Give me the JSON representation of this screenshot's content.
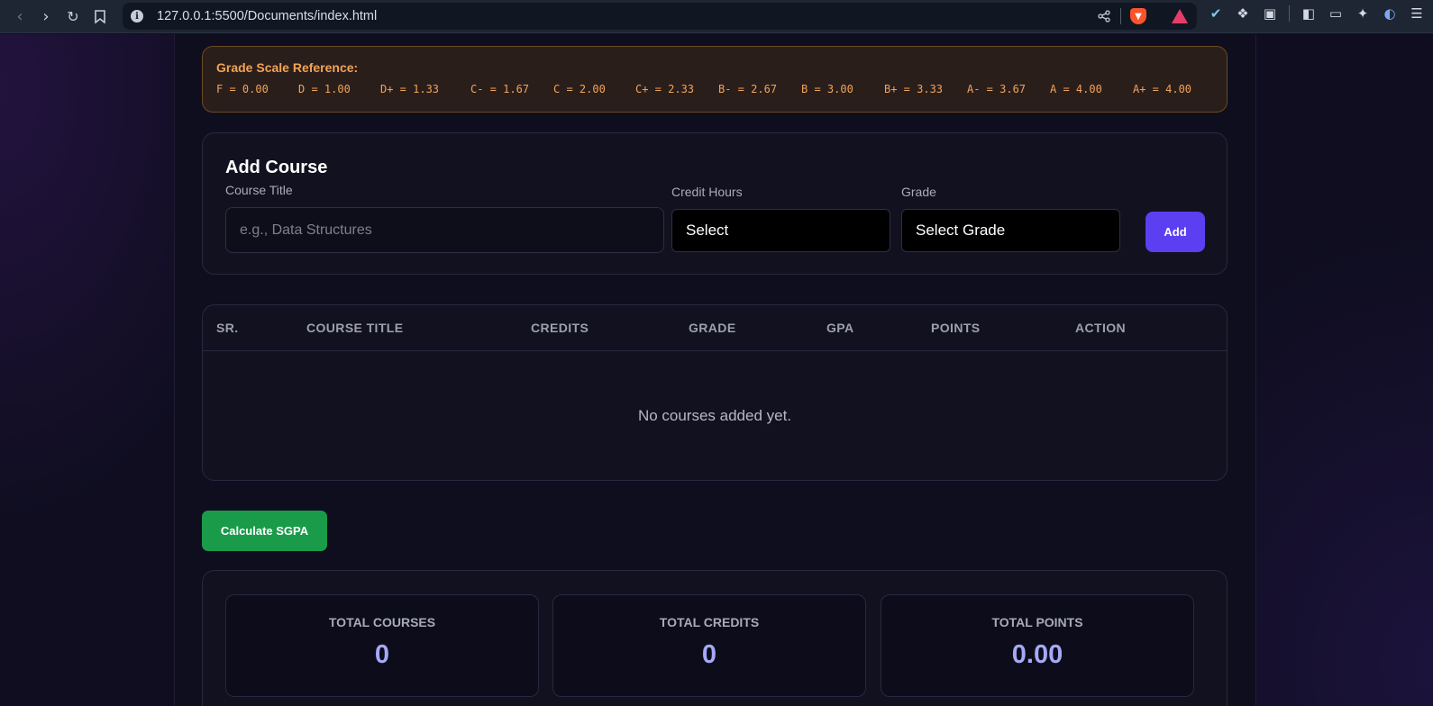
{
  "browser": {
    "url": "127.0.0.1:5500/Documents/index.html"
  },
  "grade_scale": {
    "title": "Grade Scale Reference:",
    "items": [
      "F = 0.00",
      "D = 1.00",
      "D+ = 1.33",
      "C- = 1.67",
      "C = 2.00",
      "C+ = 2.33",
      "B- = 2.67",
      "B = 3.00",
      "B+ = 3.33",
      "A- = 3.67",
      "A = 4.00",
      "A+ = 4.00"
    ]
  },
  "add_course": {
    "title": "Add Course",
    "course_title_label": "Course Title",
    "course_title_placeholder": "e.g., Data Structures",
    "credit_hours_label": "Credit Hours",
    "credit_hours_value": "Select",
    "grade_label": "Grade",
    "grade_value": "Select Grade",
    "add_button": "Add"
  },
  "table": {
    "columns": [
      "SR.",
      "COURSE TITLE",
      "CREDITS",
      "GRADE",
      "GPA",
      "POINTS",
      "ACTION"
    ],
    "empty_message": "No courses added yet."
  },
  "calculate_button": "Calculate SGPA",
  "summary": {
    "total_courses_label": "TOTAL COURSES",
    "total_courses": "0",
    "total_credits_label": "TOTAL CREDITS",
    "total_credits": "0",
    "total_points_label": "TOTAL POINTS",
    "total_points": "0.00"
  },
  "colors": {
    "accent": "#5b3ff0",
    "success": "#1a9b4a",
    "warning_text": "#f0a35a",
    "stat_value": "#a5a9f5"
  }
}
